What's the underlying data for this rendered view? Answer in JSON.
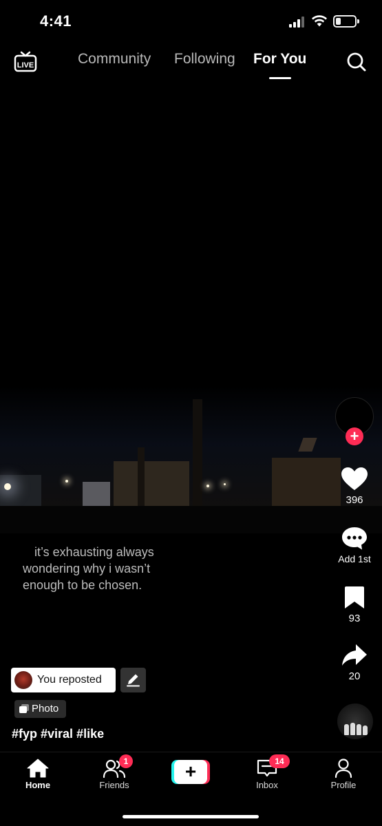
{
  "status_bar": {
    "time": "4:41",
    "icons": [
      "cellular-signal-icon",
      "wifi-icon",
      "battery-icon"
    ],
    "battery_level": 0.25
  },
  "top_nav": {
    "live_label": "LIVE",
    "tabs": [
      {
        "label": "Community",
        "active": false
      },
      {
        "label": "Following",
        "active": false
      },
      {
        "label": "For You",
        "active": true
      }
    ],
    "search_icon": "search-icon"
  },
  "post": {
    "caption_lines": [
      "it’s exhausting always",
      "wondering why i wasn’t",
      "enough to be chosen."
    ],
    "repost_label": "You reposted",
    "media_type_label": "Photo",
    "hashtags": "#fyp #viral #like"
  },
  "actions": {
    "likes": "396",
    "comments": "Add 1st",
    "bookmarks": "93",
    "shares": "20"
  },
  "bottom_nav": {
    "items": [
      {
        "label": "Home",
        "icon": "home-icon",
        "active": true
      },
      {
        "label": "Friends",
        "icon": "friends-icon",
        "badge": "1"
      },
      {
        "label": "",
        "icon": "create-plus-icon"
      },
      {
        "label": "Inbox",
        "icon": "inbox-icon",
        "badge": "14"
      },
      {
        "label": "Profile",
        "icon": "profile-icon"
      }
    ]
  },
  "colors": {
    "background": "#000000",
    "accent_red": "#fe2c55",
    "accent_cyan": "#25f4ee",
    "caption_gray": "#bdbdbd"
  }
}
